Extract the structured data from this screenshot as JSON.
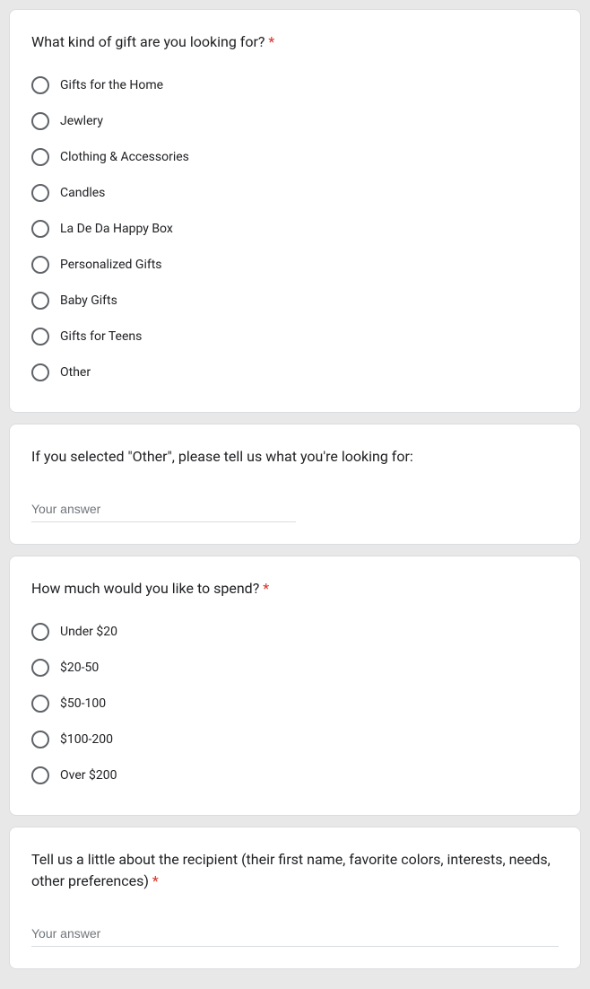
{
  "questions": [
    {
      "title": "What kind of gift are you looking for?",
      "required": true,
      "type": "radio",
      "options": [
        "Gifts for the Home",
        "Jewlery",
        "Clothing & Accessories",
        "Candles",
        "La De Da Happy Box",
        "Personalized Gifts",
        "Baby Gifts",
        "Gifts for Teens",
        "Other"
      ]
    },
    {
      "title": "If you selected \"Other\", please tell us what you're looking for:",
      "required": false,
      "type": "text",
      "placeholder": "Your answer"
    },
    {
      "title": "How much would you like to spend?",
      "required": true,
      "type": "radio",
      "options": [
        "Under $20",
        "$20-50",
        "$50-100",
        "$100-200",
        "Over $200"
      ]
    },
    {
      "title": "Tell us a little about the recipient (their first name, favorite colors, interests, needs, other preferences)",
      "required": true,
      "type": "text_full",
      "placeholder": "Your answer"
    }
  ],
  "required_marker": "*"
}
